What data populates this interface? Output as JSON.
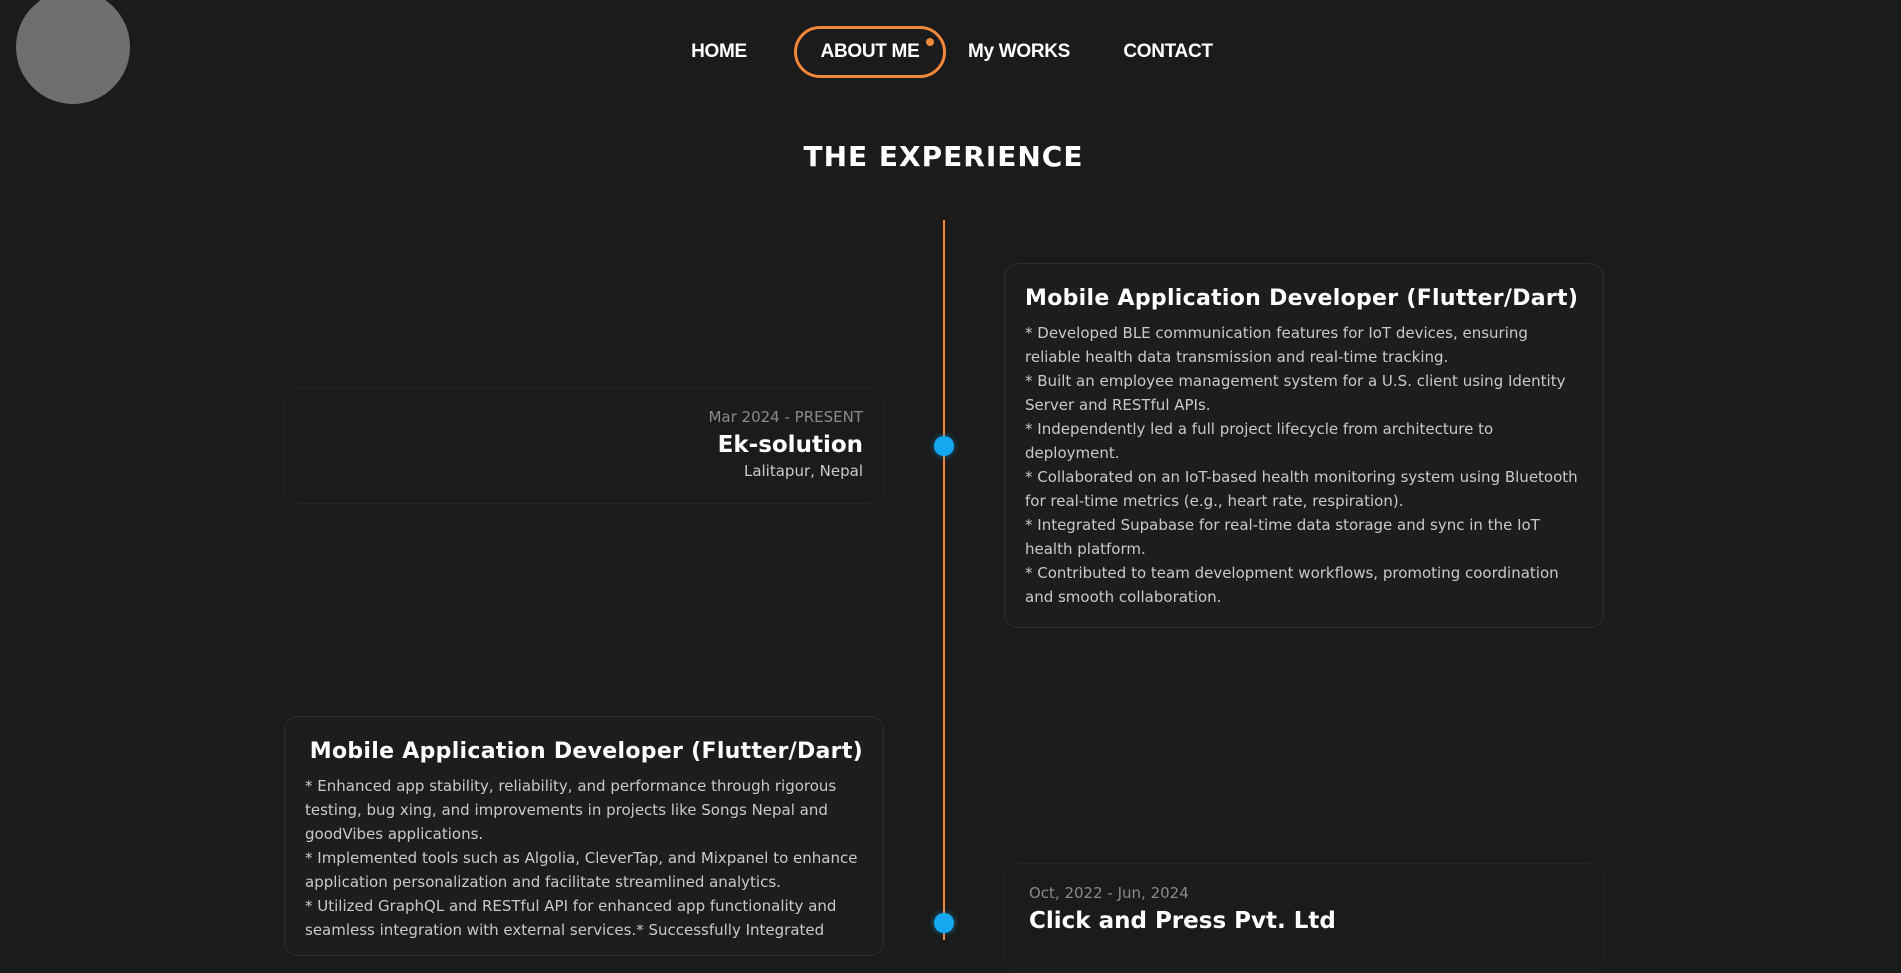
{
  "nav": {
    "items": [
      {
        "label": "HOME"
      },
      {
        "label": "ABOUT ME"
      },
      {
        "label": "My WORKS"
      },
      {
        "label": "CONTACT"
      }
    ],
    "active_index": 1
  },
  "section": {
    "title": "THE EXPERIENCE"
  },
  "experiences": [
    {
      "role": "Mobile Application Developer (Flutter/Dart)",
      "description": [
        "* Developed BLE communication features for IoT devices, ensuring reliable health data transmission and real-time tracking.",
        "* Built an employee management system for a U.S. client using Identity Server and RESTful APIs.",
        "* Independently led a full project lifecycle from architecture to deployment.",
        "* Collaborated on an IoT-based health monitoring system using Bluetooth for real-time metrics (e.g., heart rate, respiration).",
        "* Integrated Supabase for real-time data storage and sync in the IoT health platform.",
        "* Contributed to team development workflows, promoting coordination and smooth collaboration."
      ],
      "date": "Mar 2024 - PRESENT",
      "company": "Ek-solution",
      "location": "Lalitapur, Nepal"
    },
    {
      "role": "Mobile Application Developer (Flutter/Dart)",
      "description": [
        "* Enhanced app stability, reliability, and performance through rigorous testing, bug xing, and improvements in projects like Songs Nepal and goodVibes applications.",
        "* Implemented tools such as Algolia, CleverTap, and Mixpanel to enhance application personalization and facilitate streamlined analytics.",
        "* Utilized GraphQL and RESTful API for enhanced app functionality and seamless integration with external services.* Successfully Integrated"
      ],
      "date": "Oct, 2022 - Jun, 2024",
      "company": "Click and Press Pvt. Ltd"
    }
  ],
  "colors": {
    "background": "#1b1b1b",
    "accent": "#f0883b",
    "timeline_dot": "#13a8f0",
    "text_primary": "#ffffff",
    "text_secondary": "#c9c9c9",
    "text_muted": "#8a8a8a"
  }
}
